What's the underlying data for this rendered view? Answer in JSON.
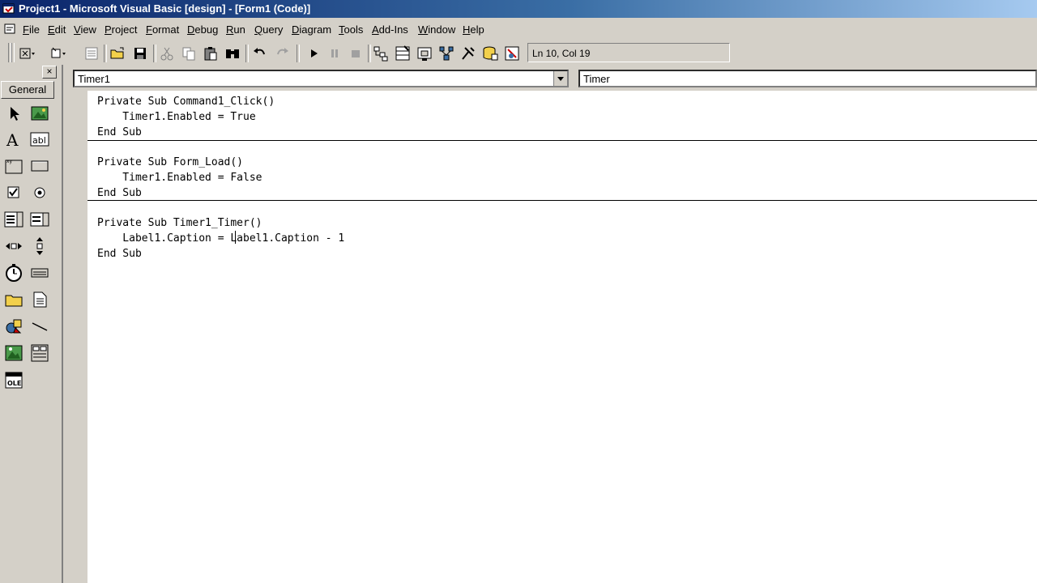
{
  "window": {
    "title": "Project1 - Microsoft Visual Basic [design] - [Form1 (Code)]"
  },
  "menu": [
    "File",
    "Edit",
    "View",
    "Project",
    "Format",
    "Debug",
    "Run",
    "Query",
    "Diagram",
    "Tools",
    "Add-Ins",
    "Window",
    "Help"
  ],
  "toolbar": {
    "position": "Ln 10, Col 19"
  },
  "toolbox": {
    "tab_label": "General",
    "close": "×"
  },
  "code": {
    "object_combo": "Timer1",
    "procedure_combo": "Timer",
    "lines": [
      "Private Sub Command1_Click()",
      "    Timer1.Enabled = True",
      "End Sub",
      "Private Sub Form_Load()",
      "    Timer1.Enabled = False",
      "End Sub",
      "Private Sub Timer1_Timer()",
      "    Label1.Caption = Label1.Caption - 1",
      "End Sub"
    ]
  },
  "colors": {
    "titlebar_start": "#0a246a",
    "titlebar_end": "#a6caf0",
    "chrome": "#d4d0c8",
    "editor_bg": "#ffffff"
  }
}
